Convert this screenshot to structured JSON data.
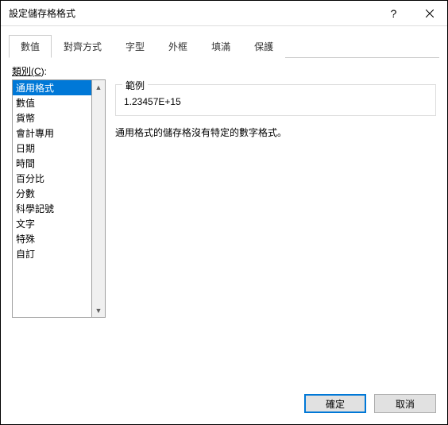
{
  "window": {
    "title": "設定儲存格格式"
  },
  "tabs": [
    {
      "label": "數值",
      "active": true
    },
    {
      "label": "對齊方式",
      "active": false
    },
    {
      "label": "字型",
      "active": false
    },
    {
      "label": "外框",
      "active": false
    },
    {
      "label": "填滿",
      "active": false
    },
    {
      "label": "保護",
      "active": false
    }
  ],
  "category_label": "類別(C):",
  "categories": [
    {
      "label": "通用格式",
      "selected": true
    },
    {
      "label": "數值",
      "selected": false
    },
    {
      "label": "貨幣",
      "selected": false
    },
    {
      "label": "會計專用",
      "selected": false
    },
    {
      "label": "日期",
      "selected": false
    },
    {
      "label": "時間",
      "selected": false
    },
    {
      "label": "百分比",
      "selected": false
    },
    {
      "label": "分數",
      "selected": false
    },
    {
      "label": "科學記號",
      "selected": false
    },
    {
      "label": "文字",
      "selected": false
    },
    {
      "label": "特殊",
      "selected": false
    },
    {
      "label": "自訂",
      "selected": false
    }
  ],
  "sample": {
    "legend": "範例",
    "value": "1.23457E+15"
  },
  "description": "通用格式的儲存格沒有特定的數字格式。",
  "buttons": {
    "ok": "確定",
    "cancel": "取消"
  }
}
